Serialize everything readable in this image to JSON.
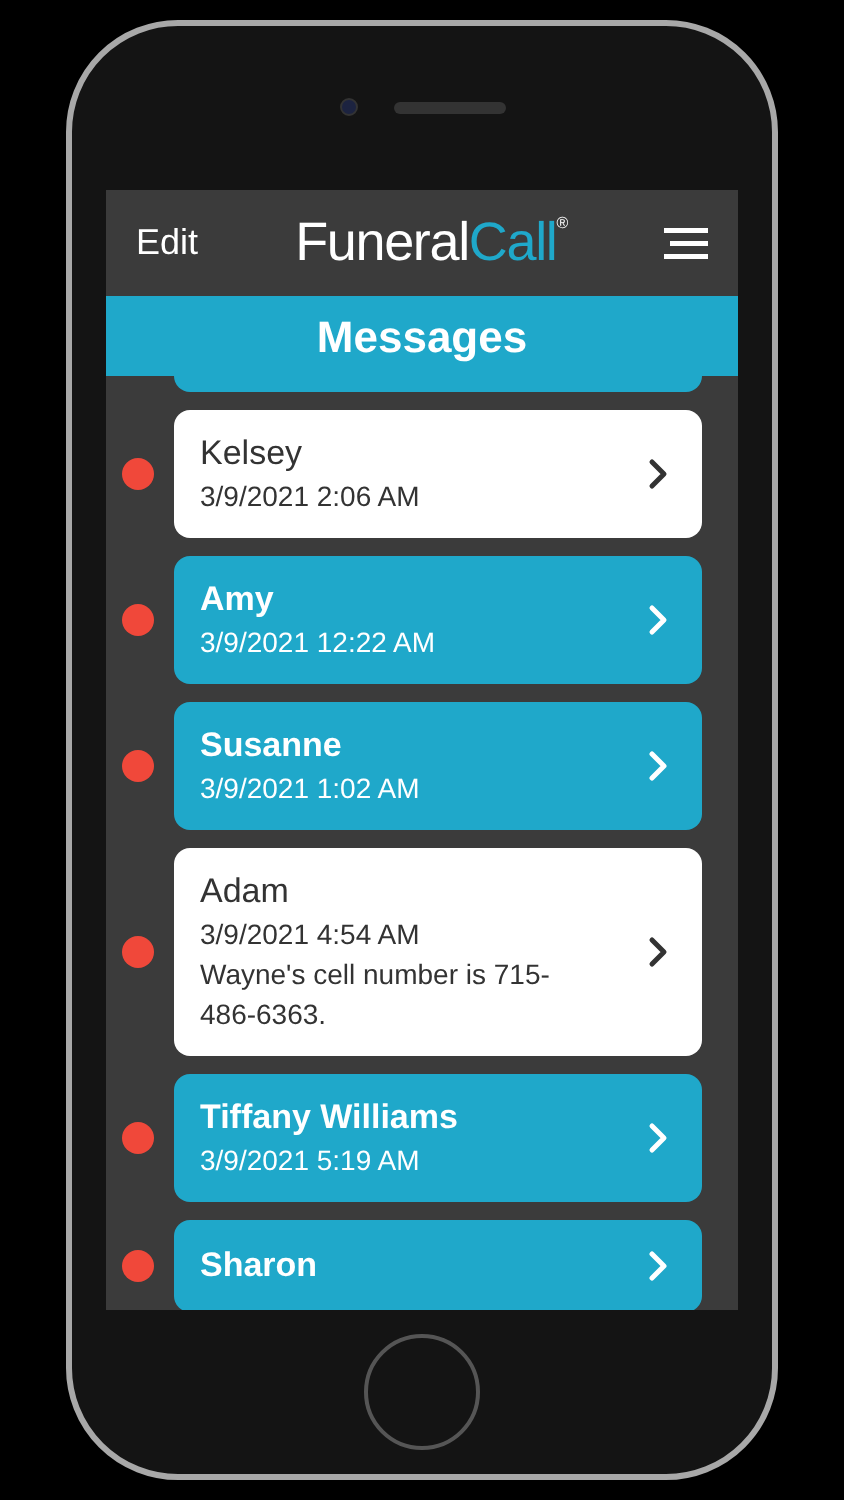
{
  "header": {
    "edit_button": "Edit",
    "logo": {
      "first": "Funeral",
      "second": "Call",
      "mark": "®"
    }
  },
  "title": "Messages",
  "messages": [
    {
      "name": "Kelsey",
      "time": "3/9/2021 2:06 AM",
      "highlighted": false,
      "unread": true
    },
    {
      "name": "Amy",
      "time": "3/9/2021 12:22 AM",
      "highlighted": true,
      "unread": true
    },
    {
      "name": "Susanne",
      "time": "3/9/2021 1:02 AM",
      "highlighted": true,
      "unread": true
    },
    {
      "name": "Adam",
      "time": "3/9/2021 4:54 AM",
      "preview": "Wayne's cell number is 715-486-6363.",
      "highlighted": false,
      "unread": true
    },
    {
      "name": "Tiffany Williams",
      "time": "3/9/2021 5:19 AM",
      "highlighted": true,
      "unread": true
    },
    {
      "name": "Sharon",
      "highlighted": true,
      "unread": true
    }
  ]
}
